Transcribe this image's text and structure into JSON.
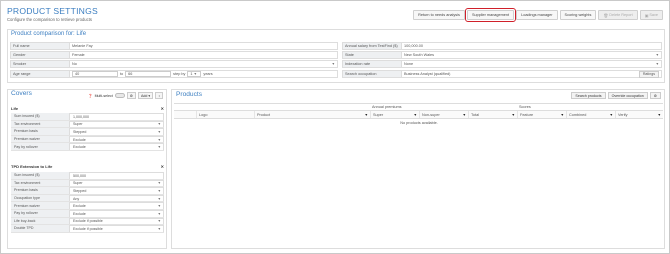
{
  "header": {
    "title": "PRODUCT SETTINGS",
    "subtitle": "Configure the comparison to retrieve products"
  },
  "toolbar": {
    "return": "Return to needs analysis",
    "supplier": "Supplier management",
    "loadings": "Loadings manager",
    "scoring": "Scoring weights",
    "delete": "Delete Report",
    "save": "Save"
  },
  "comparison": {
    "title": "Product comparison for: Life",
    "full_name_label": "Full name",
    "full_name": "Melanie Fay",
    "gender_label": "Gender",
    "gender": "Female",
    "smoker_label": "Smoker",
    "smoker": "No",
    "age_label": "Age range",
    "age_from": "40",
    "age_to_label": "to",
    "age_to": "66",
    "step_label": "step by",
    "step": "1",
    "years": "years",
    "salary_label": "Annual salary from TestFind ($)",
    "salary": "100,000.00",
    "state_label": "State",
    "state": "New South Wales",
    "indexation_label": "Indexation rate",
    "indexation": "None",
    "occupation_label": "Search occupation",
    "occupation": "Business Analyst (qualified)",
    "ratings": "Ratings"
  },
  "covers": {
    "title": "Covers",
    "multiselect": "Multi-select",
    "add": "Add",
    "life_title": "Life",
    "life": [
      {
        "label": "Sum insured ($)",
        "value": "1,000,000"
      },
      {
        "label": "Tax environment",
        "value": "Super"
      },
      {
        "label": "Premium basis",
        "value": "Stepped"
      },
      {
        "label": "Premium waiver",
        "value": "Exclude"
      },
      {
        "label": "Pay by rollover",
        "value": "Exclude"
      }
    ],
    "tpd_title": "TPD Extension to Life",
    "tpd": [
      {
        "label": "Sum insured ($)",
        "value": "500,000"
      },
      {
        "label": "Tax environment",
        "value": "Super"
      },
      {
        "label": "Premium basis",
        "value": "Stepped"
      },
      {
        "label": "Occupation type",
        "value": "Any"
      },
      {
        "label": "Premium waiver",
        "value": "Exclude"
      },
      {
        "label": "Pay by rollover",
        "value": "Exclude"
      },
      {
        "label": "Life buy-back",
        "value": "Exclude if possible"
      },
      {
        "label": "Double TPD",
        "value": "Exclude if possible"
      }
    ]
  },
  "products": {
    "title": "Products",
    "search": "Search products",
    "override": "Override occupation",
    "group_premiums": "Annual premiums",
    "group_scores": "Scores",
    "columns": [
      "Logo",
      "Product",
      "Super",
      "Non-super",
      "Total",
      "Feature",
      "Combined",
      "Verify"
    ],
    "empty": "No products available."
  },
  "colors": {
    "accent": "#3d7fc1",
    "highlight": "#d0202a"
  }
}
